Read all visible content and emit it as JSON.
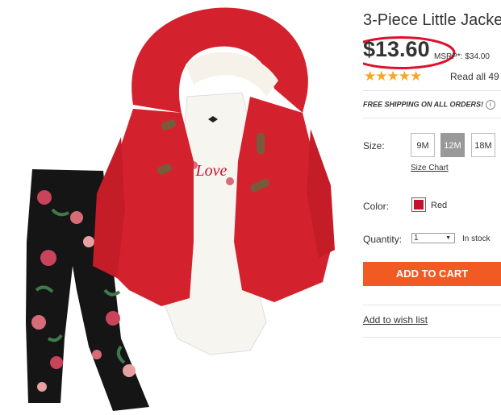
{
  "product": {
    "title": "3-Piece Little Jacke",
    "price": "$13.60",
    "msrp": "MSRP*: $34.00",
    "rating": 4.5,
    "stars": "★★★★★",
    "reviews": "Read all 49",
    "shipping": "FREE SHIPPING ON ALL ORDERS!",
    "info_icon": "i",
    "size_label": "Size:",
    "sizes": [
      "9M",
      "12M",
      "18M"
    ],
    "selected_size": "12M",
    "size_chart": "Size Chart",
    "color_label": "Color:",
    "color_value": "Red",
    "quantity_label": "Quantity:",
    "quantity_value": "1",
    "stock": "In stock",
    "add_to_cart": "ADD TO CART",
    "wishlist": "Add to wish list",
    "shirt_text": "Love",
    "colors": {
      "accent": "#f15a22",
      "swatch": "#c4122e",
      "highlight": "#e0102a",
      "star": "#f5a623"
    }
  }
}
